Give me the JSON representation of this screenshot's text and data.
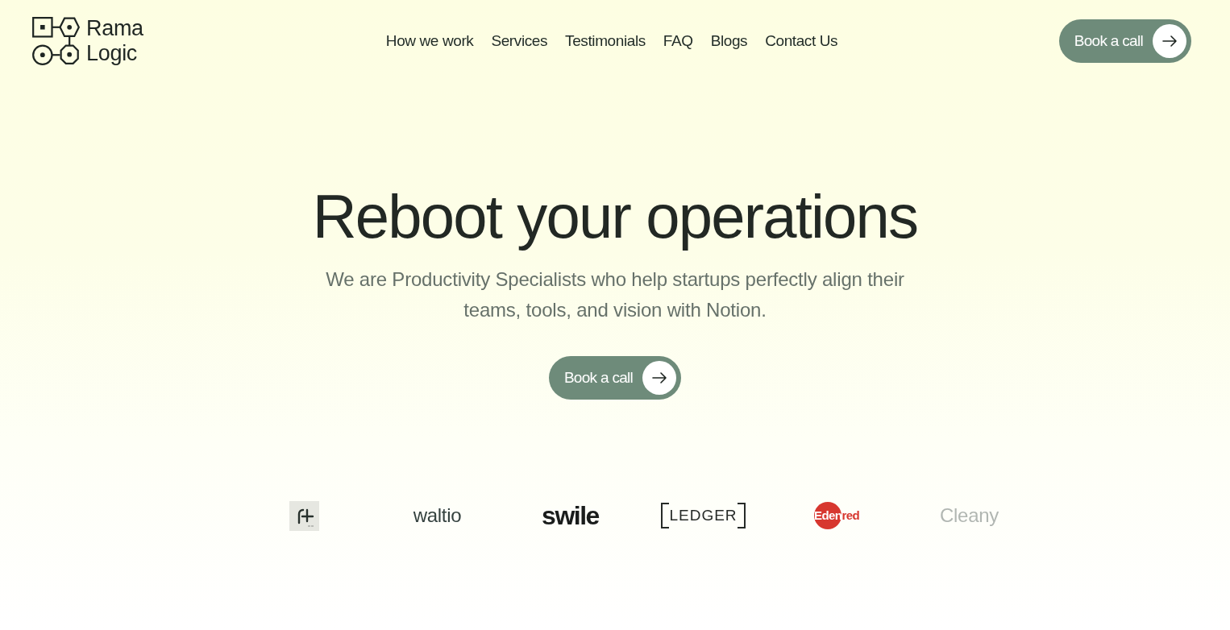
{
  "header": {
    "logo": {
      "name": "Rama Logic"
    },
    "nav": [
      {
        "label": "How we work"
      },
      {
        "label": "Services"
      },
      {
        "label": "Testimonials"
      },
      {
        "label": "FAQ"
      },
      {
        "label": "Blogs"
      },
      {
        "label": "Contact Us"
      }
    ],
    "cta": {
      "label": "Book a call"
    }
  },
  "hero": {
    "title": "Reboot your operations",
    "subtitle": "We are Productivity Specialists who help startups perfectly align their teams, tools, and vision with Notion.",
    "cta": {
      "label": "Book a call"
    }
  },
  "client_logos": [
    {
      "kind": "image",
      "faded": false
    },
    {
      "kind": "wordmark",
      "text": "waltio",
      "faded": false
    },
    {
      "kind": "heavy",
      "text": "swile",
      "faded": false
    },
    {
      "kind": "bracketed",
      "text": "LEDGER",
      "faded": false
    },
    {
      "kind": "disc",
      "text": "Edenred",
      "faded": false
    },
    {
      "kind": "wordmark",
      "text": "Cleany",
      "faded": true
    }
  ]
}
